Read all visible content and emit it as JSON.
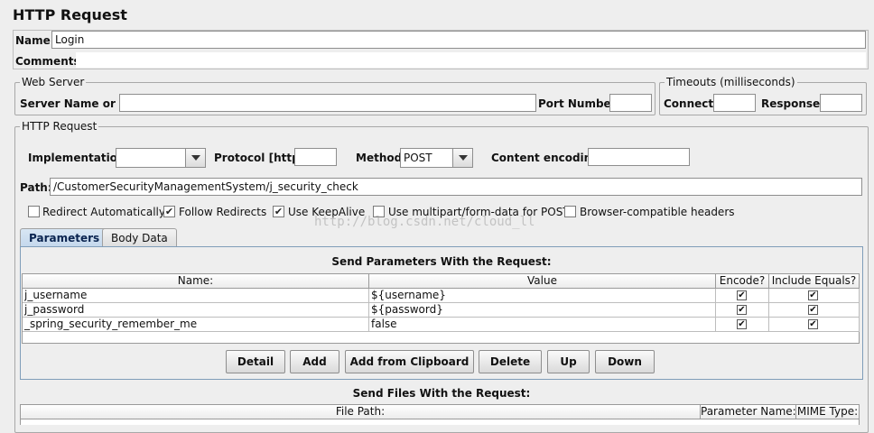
{
  "title": "HTTP Request",
  "name": {
    "label": "Name:",
    "value": "Login"
  },
  "comments": {
    "label": "Comments:",
    "value": ""
  },
  "web_server": {
    "title": "Web Server",
    "server_label": "Server Name or IP:",
    "server_value": "",
    "port_label": "Port Number:",
    "port_value": ""
  },
  "timeouts": {
    "title": "Timeouts (milliseconds)",
    "connect_label": "Connect:",
    "connect_value": "",
    "response_label": "Response:",
    "response_value": ""
  },
  "http_request": {
    "title": "HTTP Request",
    "implementation_label": "Implementation:",
    "implementation_value": "",
    "protocol_label": "Protocol [http]:",
    "protocol_value": "",
    "method_label": "Method:",
    "method_value": "POST",
    "encoding_label": "Content encoding:",
    "encoding_value": "",
    "path_label": "Path:",
    "path_value": "/CustomerSecurityManagementSystem/j_security_check"
  },
  "options": [
    {
      "label": "Redirect Automatically",
      "checked": false
    },
    {
      "label": "Follow Redirects",
      "checked": true
    },
    {
      "label": "Use KeepAlive",
      "checked": true
    },
    {
      "label": "Use multipart/form-data for POST",
      "checked": false
    },
    {
      "label": "Browser-compatible headers",
      "checked": false
    }
  ],
  "tabs": [
    {
      "label": "Parameters",
      "active": true
    },
    {
      "label": "Body Data",
      "active": false
    }
  ],
  "params": {
    "heading": "Send Parameters With the Request:",
    "columns": [
      "Name:",
      "Value",
      "Encode?",
      "Include Equals?"
    ],
    "rows": [
      {
        "name": "j_username",
        "value": "${username}",
        "encode": true,
        "include_equals": true
      },
      {
        "name": "j_password",
        "value": "${password}",
        "encode": true,
        "include_equals": true
      },
      {
        "name": "_spring_security_remember_me",
        "value": "false",
        "encode": true,
        "include_equals": true
      }
    ]
  },
  "buttons": [
    "Detail",
    "Add",
    "Add from Clipboard",
    "Delete",
    "Up",
    "Down"
  ],
  "files": {
    "heading": "Send Files With the Request:",
    "columns": [
      "File Path:",
      "Parameter Name:",
      "MIME Type:"
    ]
  },
  "watermark": "http://blog.csdn.net/cloud_ll"
}
